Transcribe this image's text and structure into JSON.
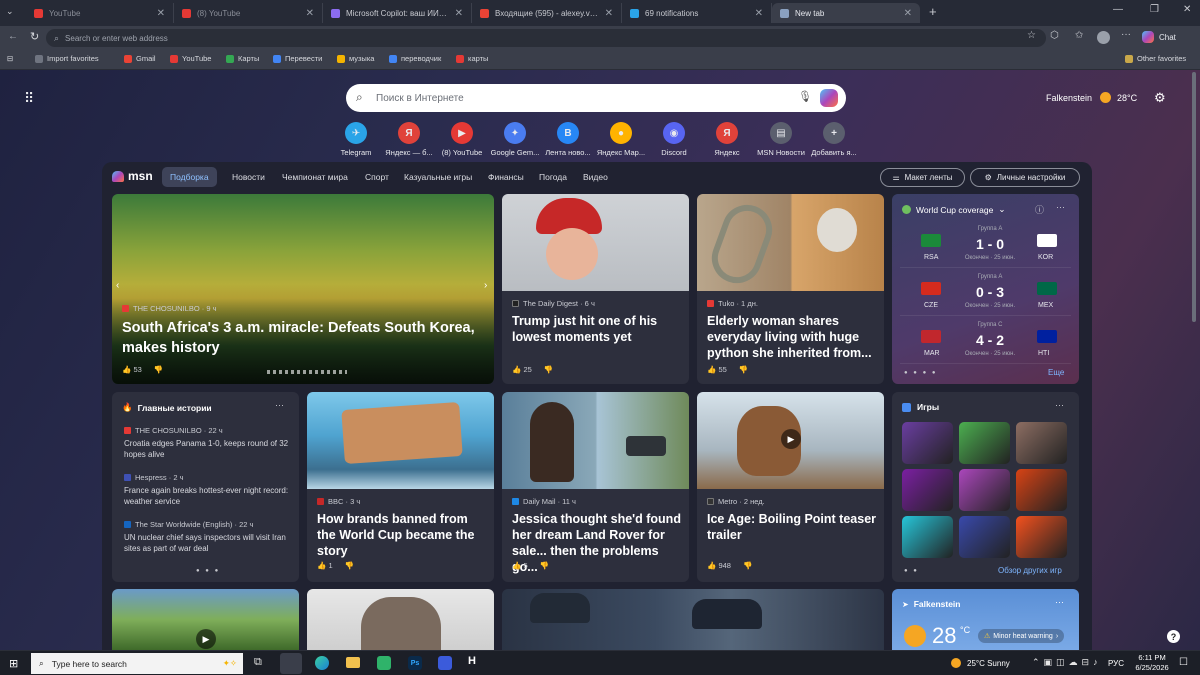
{
  "tabs": [
    {
      "title": "YouTube",
      "color": "#e53935"
    },
    {
      "title": "(8) YouTube",
      "color": "#e53935"
    },
    {
      "title": "Microsoft Copilot: ваш ИИ-помо",
      "color": "#8b6cf0"
    },
    {
      "title": "Входящие (595) - alexey.voronts",
      "color": "#ea4335"
    },
    {
      "title": "69 notifications",
      "color": "#2aa4e8"
    },
    {
      "title": "New tab",
      "color": "#8aa0c0"
    }
  ],
  "address": {
    "placeholder": "Search or enter web address"
  },
  "chat_label": "Chat",
  "favorites": {
    "import": "Import favorites",
    "items": [
      {
        "label": "Gmail",
        "color": "#ea4335"
      },
      {
        "label": "YouTube",
        "color": "#e53935"
      },
      {
        "label": "Карты",
        "color": "#34a853"
      },
      {
        "label": "Перевести",
        "color": "#4285f4"
      },
      {
        "label": "музыка",
        "color": "#f4b400"
      },
      {
        "label": "переводчик",
        "color": "#4285f4"
      },
      {
        "label": "карты",
        "color": "#e53935"
      }
    ],
    "other": "Other favorites"
  },
  "search": {
    "placeholder": "Поиск в Интернете"
  },
  "weather": {
    "city": "Falkenstein",
    "temp": "28°C"
  },
  "quick_links": [
    {
      "label": "Telegram",
      "glyph": "✈",
      "color": "#2aa4e8"
    },
    {
      "label": "Яндекс — б...",
      "glyph": "Я",
      "color": "#e0423a"
    },
    {
      "label": "(8) YouTube",
      "glyph": "▶",
      "color": "#e53935"
    },
    {
      "label": "Google Gem...",
      "glyph": "✦",
      "color": "#4a7cf0"
    },
    {
      "label": "Лента ново...",
      "glyph": "В",
      "color": "#2787f5"
    },
    {
      "label": "Яндекс Мар...",
      "glyph": "●",
      "color": "#ffb300"
    },
    {
      "label": "Discord",
      "glyph": "◉",
      "color": "#5865f2"
    },
    {
      "label": "Яндекс",
      "glyph": "Я",
      "color": "#e0423a"
    },
    {
      "label": "MSN Новости",
      "glyph": "▤",
      "color": "#5b5f6e"
    },
    {
      "label": "Добавить я...",
      "glyph": "+",
      "color": "#5b5f6e"
    }
  ],
  "msn": {
    "logo": "msn",
    "nav": [
      "Подборка",
      "Новости",
      "Чемпионат мира",
      "Спорт",
      "Казуальные игры",
      "Финансы",
      "Погода",
      "Видео"
    ],
    "layout_btn": "Макет ленты",
    "personal_btn": "Личные настройки"
  },
  "hero": {
    "source": "THE CHOSUNILBO · 9 ч",
    "title": "South Africa's 3 a.m. miracle: Defeats South Korea, makes history",
    "likes": "53"
  },
  "cards_top": [
    {
      "source": "The Daily Digest · 6 ч",
      "title": "Trump just hit one of his lowest moments yet",
      "likes": "25",
      "src_color": "#222222"
    },
    {
      "source": "Tuko · 1 дн.",
      "title": "Elderly woman shares everyday living with huge python she inherited from...",
      "likes": "55",
      "src_color": "#e53935"
    }
  ],
  "worldcup": {
    "title": "World Cup coverage",
    "more": "Еще",
    "matches": [
      {
        "group": "Группа А",
        "home": "RSA",
        "away": "KOR",
        "score": "1 - 0",
        "status": "Окончен · 25 июн.",
        "home_color": "#1b8a3a",
        "away_color": "#ffffff"
      },
      {
        "group": "Группа А",
        "home": "CZE",
        "away": "MEX",
        "score": "0 - 3",
        "status": "Окончен · 25 июн.",
        "home_color": "#d52b1e",
        "away_color": "#006847"
      },
      {
        "group": "Группа С",
        "home": "MAR",
        "away": "HTI",
        "score": "4 - 2",
        "status": "Окончен · 25 июн.",
        "home_color": "#c1272d",
        "away_color": "#00209f"
      }
    ]
  },
  "top_stories": {
    "title": "Главные истории",
    "items": [
      {
        "source": "THE CHOSUNILBO · 22 ч",
        "title": "Croatia edges Panama 1-0, keeps round of 32 hopes alive",
        "color": "#e53935"
      },
      {
        "source": "Hespress · 2 ч",
        "title": "France again breaks hottest-ever night record: weather service",
        "color": "#3f51b5"
      },
      {
        "source": "The Star Worldwide (English) · 22 ч",
        "title": "UN nuclear chief says inspectors will visit Iran sites as part of war deal",
        "color": "#1565c0"
      }
    ]
  },
  "cards_mid": [
    {
      "source": "BBC · 3 ч",
      "title": "How brands banned from the World Cup became the story",
      "likes": "1",
      "src_color": "#c62828"
    },
    {
      "source": "Daily Mail · 11 ч",
      "title": "Jessica thought she'd found her dream Land Rover for sale... then the problems go...",
      "likes": "5",
      "src_color": "#1e88e5"
    },
    {
      "source": "Metro · 2 нед.",
      "title": "Ice Age: Boiling Point teaser trailer",
      "likes": "948",
      "src_color": "#333333"
    }
  ],
  "games": {
    "title": "Игры",
    "more": "Обзор других игр",
    "thumbs": [
      "#6a3ea1",
      "#4caf50",
      "#8d6e63",
      "#7b1fa2",
      "#ab47bc",
      "#d84315",
      "#26c6da",
      "#3949ab",
      "#f4511e"
    ]
  },
  "weather_card": {
    "city": "Falkenstein",
    "temp": "28",
    "unit": "°C",
    "alert": "Minor heat warning"
  },
  "taskbar": {
    "search": "Type here to search",
    "weather": "25°C  Sunny",
    "lang": "РУС",
    "time": "6:11 PM",
    "date": "6/25/2026"
  }
}
